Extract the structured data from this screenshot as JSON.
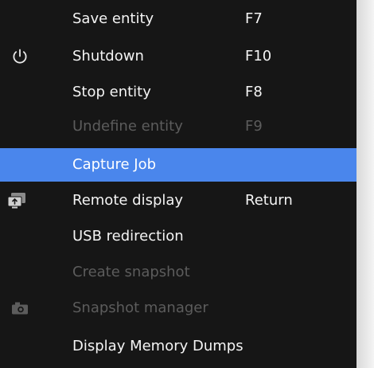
{
  "menu": {
    "items": [
      {
        "label": "Save entity",
        "shortcut": "F7",
        "icon": "",
        "disabled": false,
        "selected": false
      },
      {
        "label": "Shutdown",
        "shortcut": "F10",
        "icon": "power-icon",
        "disabled": false,
        "selected": false
      },
      {
        "label": "Stop entity",
        "shortcut": "F8",
        "icon": "",
        "disabled": false,
        "selected": false
      },
      {
        "label": "Undefine entity",
        "shortcut": "F9",
        "icon": "",
        "disabled": true,
        "selected": false
      },
      {
        "label": "Capture Job",
        "shortcut": "",
        "icon": "",
        "disabled": false,
        "selected": true
      },
      {
        "label": "Remote display",
        "shortcut": "Return",
        "icon": "remote-display-icon",
        "disabled": false,
        "selected": false
      },
      {
        "label": "USB redirection",
        "shortcut": "",
        "icon": "",
        "disabled": false,
        "selected": false
      },
      {
        "label": "Create snapshot",
        "shortcut": "",
        "icon": "",
        "disabled": true,
        "selected": false
      },
      {
        "label": "Snapshot manager",
        "shortcut": "",
        "icon": "camera-icon",
        "disabled": true,
        "selected": false
      },
      {
        "label": "Display Memory Dumps",
        "shortcut": "",
        "icon": "",
        "disabled": false,
        "selected": false
      }
    ]
  },
  "colors": {
    "menu_background": "#161616",
    "highlight": "#4a86ec",
    "text": "#f4f4f4",
    "disabled_text": "#5c5c5c"
  }
}
